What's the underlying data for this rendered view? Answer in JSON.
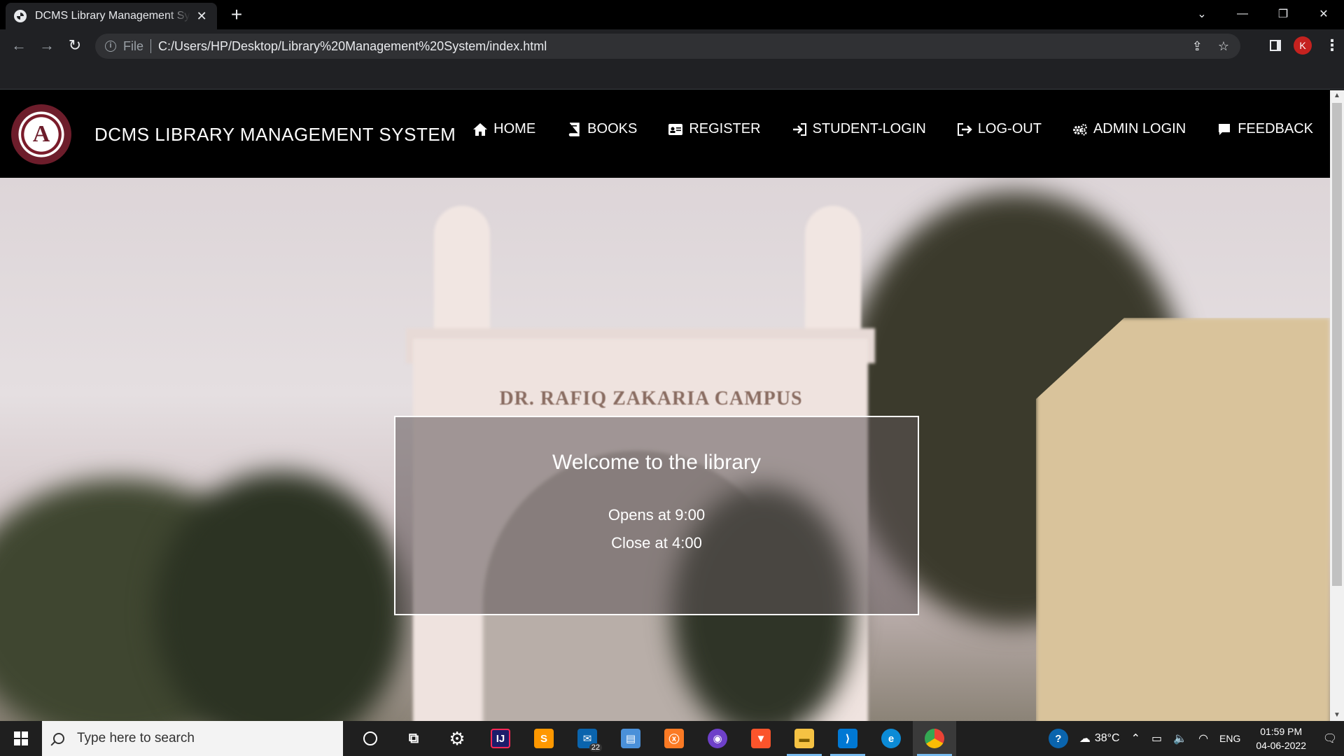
{
  "browser": {
    "tab_title": "DCMS Library Management System",
    "tab_close": "✕",
    "new_tab": "+",
    "url_scheme": "File",
    "url": "C:/Users/HP/Desktop/Library%20Management%20System/index.html",
    "profile_initial": "K"
  },
  "site": {
    "title": "DCMS LIBRARY MANAGEMENT SYSTEM",
    "menu": [
      {
        "label": "HOME",
        "icon": "home-icon"
      },
      {
        "label": "BOOKS",
        "icon": "book-icon"
      },
      {
        "label": "REGISTER",
        "icon": "id-card-icon"
      },
      {
        "label": "STUDENT-LOGIN",
        "icon": "sign-in-icon"
      },
      {
        "label": "LOG-OUT",
        "icon": "sign-out-icon"
      },
      {
        "label": "ADMIN LOGIN",
        "icon": "gears-icon"
      },
      {
        "label": "FEEDBACK",
        "icon": "comment-icon"
      }
    ]
  },
  "hero": {
    "campus_sign": "DR. RAFIQ ZAKARIA CAMPUS",
    "welcome": "Welcome to the library",
    "opens": "Opens at 9:00",
    "closes": "Close at 4:00"
  },
  "taskbar": {
    "search_placeholder": "Type here to search",
    "mail_badge": "22",
    "weather": "38°C",
    "language": "ENG",
    "time": "01:59 PM",
    "date": "04-06-2022",
    "accent": "#76b9ed"
  },
  "colors": {
    "browser_bg": "#202124",
    "nav_bg": "#000000",
    "avatar": "#c5221f"
  }
}
